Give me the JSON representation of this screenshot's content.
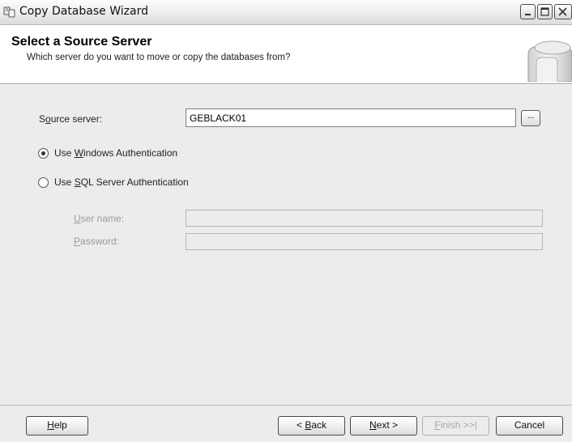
{
  "window": {
    "title": "Copy Database Wizard"
  },
  "header": {
    "title": "Select a Source Server",
    "subtitle": "Which server do you want to move or copy the databases from?"
  },
  "form": {
    "source_server": {
      "label_pre": "S",
      "label_access": "o",
      "label_post": "urce server:",
      "value": "GEBLACK01",
      "browse_label": "..."
    },
    "windows_auth": {
      "label_pre": "Use ",
      "label_access": "W",
      "label_post": "indows Authentication",
      "selected": true
    },
    "sql_auth": {
      "label_pre": "Use ",
      "label_access": "S",
      "label_post": "QL Server Authentication",
      "selected": false
    },
    "user_name": {
      "label_access": "U",
      "label_post": "ser name:",
      "value": ""
    },
    "password": {
      "label_access": "P",
      "label_post": "assword:",
      "value": ""
    }
  },
  "buttons": {
    "help": {
      "access": "H",
      "rest": "elp"
    },
    "back": {
      "pre": "< ",
      "access": "B",
      "rest": "ack"
    },
    "next": {
      "access": "N",
      "rest": "ext >"
    },
    "finish": {
      "access": "F",
      "rest": "inish >>|"
    },
    "cancel": {
      "label": "Cancel"
    }
  }
}
